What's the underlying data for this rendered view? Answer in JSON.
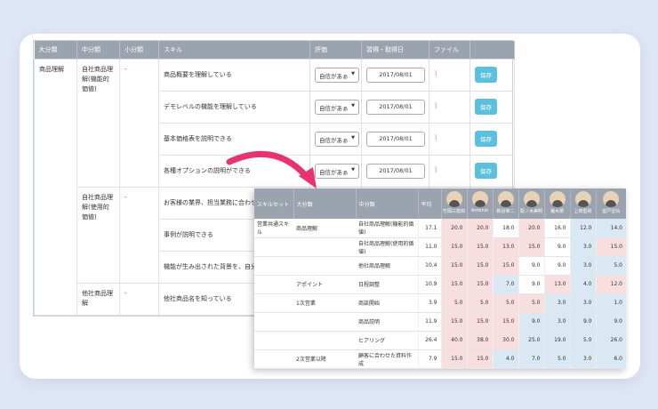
{
  "back_table": {
    "headers": [
      "大分類",
      "中分類",
      "小分類",
      "スキル",
      "評価",
      "習得・取得日",
      "ファイル",
      ""
    ],
    "select_value": "自信があぁ",
    "date_value": "2017/08/01",
    "save_label": "保存",
    "dash": "-",
    "groups": [
      {
        "major": "商品理解",
        "mid": "自社商品理解(機能的価値)"
      },
      {
        "mid": "自社商品理解(使用的価値)"
      },
      {
        "mid": "他社商品理解"
      }
    ],
    "skills": [
      "商品概要を理解している",
      "デモレベルの機能を理解している",
      "基本価格表を説明できる",
      "各種オプションの説明ができる",
      "お客様の業界、担当業務に合わせた",
      "事例が説明できる",
      "機能が生み出された背景を、自分の",
      "他社商品名を知っている"
    ]
  },
  "front_table": {
    "headers": [
      "スキルセット",
      "大分類",
      "中分類",
      "平均"
    ],
    "people": [
      "竹岡三枝郎",
      "Antonio",
      "新谷宰二",
      "配ノ木美明",
      "猪木那",
      "上田堅和",
      "室戸宝仙"
    ],
    "rows": [
      {
        "set": "営業共通スキル",
        "major": "商品理解",
        "mid": "自社商品理解(機能的価値)",
        "avg": "17.1",
        "vals": [
          "20.0",
          "20.0",
          "18.0",
          "20.0",
          "16.0",
          "12.0",
          "14.0"
        ],
        "colors": [
          "pink",
          "pink",
          "white",
          "pink",
          "white",
          "blue",
          "blue"
        ]
      },
      {
        "set": "",
        "major": "",
        "mid": "自社商品理解(使用的価値)",
        "avg": "11.0",
        "vals": [
          "15.0",
          "15.0",
          "13.0",
          "15.0",
          "9.0",
          "3.0",
          "15.0"
        ],
        "colors": [
          "pink",
          "pink",
          "pink",
          "pink",
          "white",
          "blue",
          "pink"
        ]
      },
      {
        "set": "",
        "major": "",
        "mid": "他社商品理解",
        "avg": "10.4",
        "vals": [
          "15.0",
          "15.0",
          "15.0",
          "9.0",
          "9.0",
          "3.0",
          "5.0"
        ],
        "colors": [
          "pink",
          "pink",
          "pink",
          "white",
          "white",
          "blue",
          "blue"
        ]
      },
      {
        "set": "",
        "major": "アポイント",
        "mid": "日程調整",
        "avg": "10.9",
        "vals": [
          "15.0",
          "15.0",
          "7.0",
          "9.0",
          "13.0",
          "4.0",
          "12.0"
        ],
        "colors": [
          "pink",
          "pink",
          "blue",
          "white",
          "pink",
          "blue",
          "pink"
        ]
      },
      {
        "set": "",
        "major": "1次営業",
        "mid": "商談開始",
        "avg": "3.9",
        "vals": [
          "5.0",
          "5.0",
          "5.0",
          "5.0",
          "3.0",
          "3.0",
          "1.0"
        ],
        "colors": [
          "pink",
          "pink",
          "pink",
          "pink",
          "blue",
          "blue",
          "blue"
        ]
      },
      {
        "set": "",
        "major": "",
        "mid": "商品説明",
        "avg": "11.9",
        "vals": [
          "15.0",
          "15.0",
          "15.0",
          "9.0",
          "3.0",
          "9.0",
          "9.0"
        ],
        "colors": [
          "pink",
          "pink",
          "pink",
          "blue",
          "blue",
          "blue",
          "blue"
        ]
      },
      {
        "set": "",
        "major": "",
        "mid": "ヒアリング",
        "avg": "26.4",
        "vals": [
          "40.0",
          "38.0",
          "30.0",
          "25.0",
          "19.0",
          "5.0",
          "26.0"
        ],
        "colors": [
          "pink",
          "pink",
          "pink",
          "blue",
          "blue",
          "blue",
          "blue"
        ]
      },
      {
        "set": "",
        "major": "2次営業以降",
        "mid": "顧客に合わせた資料作成",
        "avg": "7.9",
        "vals": [
          "15.0",
          "15.0",
          "4.0",
          "7.0",
          "5.0",
          "3.0",
          "6.0"
        ],
        "colors": [
          "pink",
          "pink",
          "blue",
          "blue",
          "blue",
          "blue",
          "blue"
        ]
      }
    ]
  },
  "colors": {
    "header": "#9aa3ae",
    "save": "#5bc0de",
    "arrow": "#e8336d",
    "pink": "#f9dee0",
    "blue": "#d9e8f3"
  }
}
